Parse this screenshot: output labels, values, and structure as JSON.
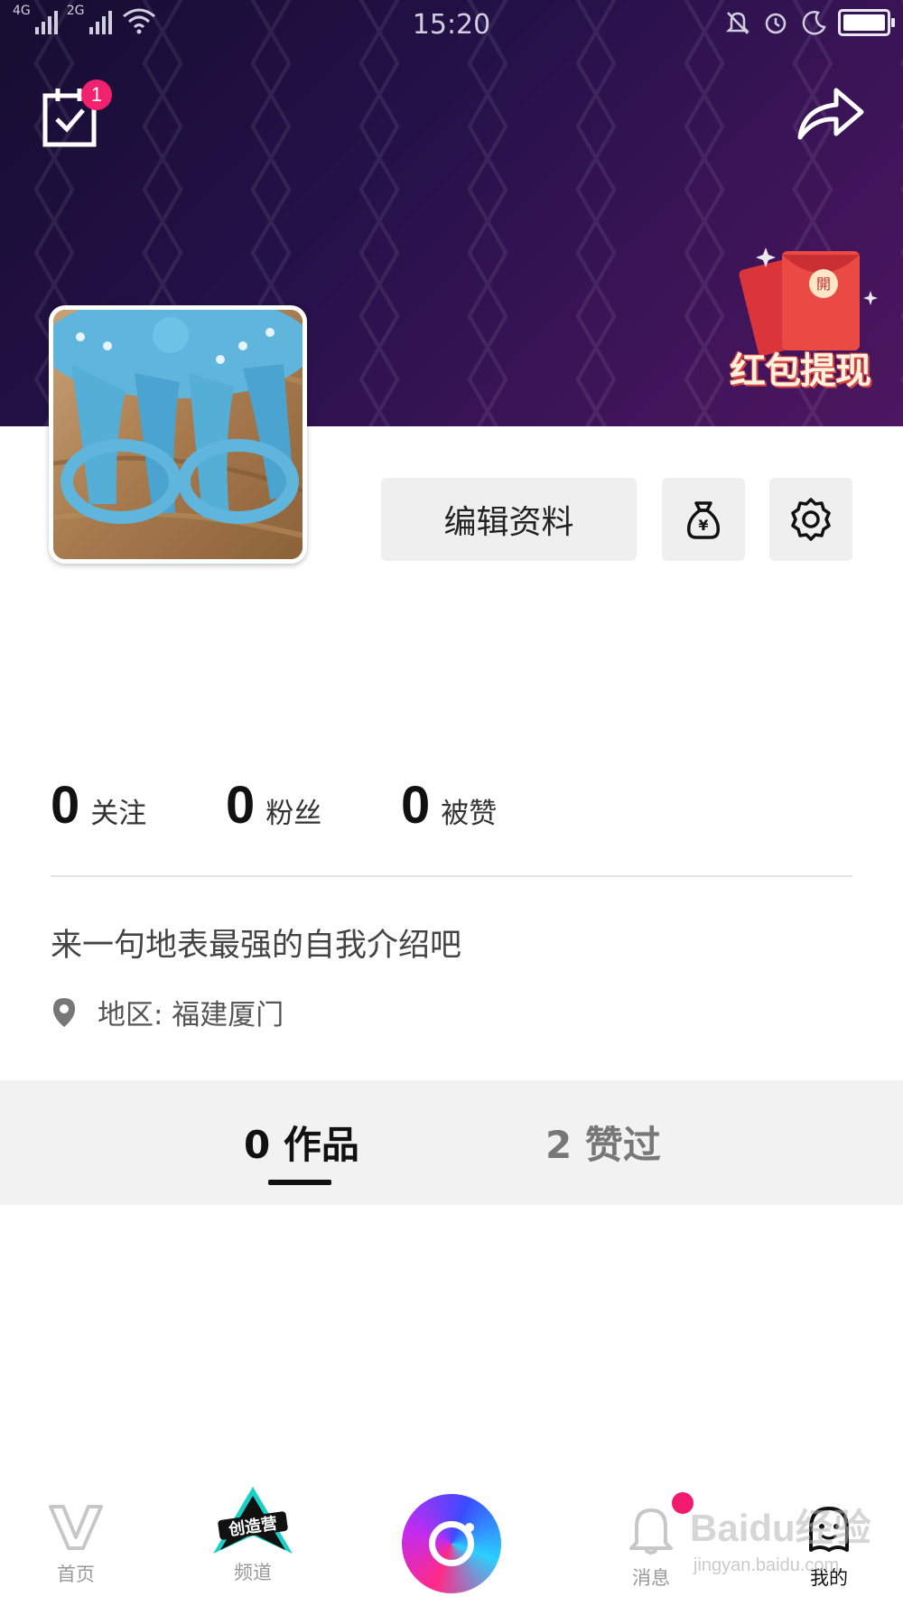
{
  "status_bar": {
    "signal1_label": "4G",
    "signal2_label": "2G",
    "time": "15:20",
    "icons": [
      "signal-icon",
      "wifi-icon",
      "bell-muted-icon",
      "alarm-icon",
      "moon-icon",
      "battery-icon"
    ]
  },
  "header": {
    "task_badge": "1",
    "promo_label": "红包提现",
    "promo_envelope_text": "開",
    "accent": "#f2216e"
  },
  "profile": {
    "edit_label": "编辑资料",
    "wallet_glyph": "¥",
    "stats": [
      {
        "num": "0",
        "label": "关注"
      },
      {
        "num": "0",
        "label": "粉丝"
      },
      {
        "num": "0",
        "label": "被赞"
      }
    ],
    "bio": "来一句地表最强的自我介绍吧",
    "region": "地区: 福建厦门"
  },
  "tabs": {
    "works": "0 作品",
    "likes": "2 赞过"
  },
  "nav": {
    "home": "首页",
    "channel": "频道",
    "channel_logo": "创造营",
    "messages": "消息",
    "me": "我的"
  },
  "watermark": {
    "main": "Baidu经验",
    "sub": "jingyan.baidu.com"
  }
}
